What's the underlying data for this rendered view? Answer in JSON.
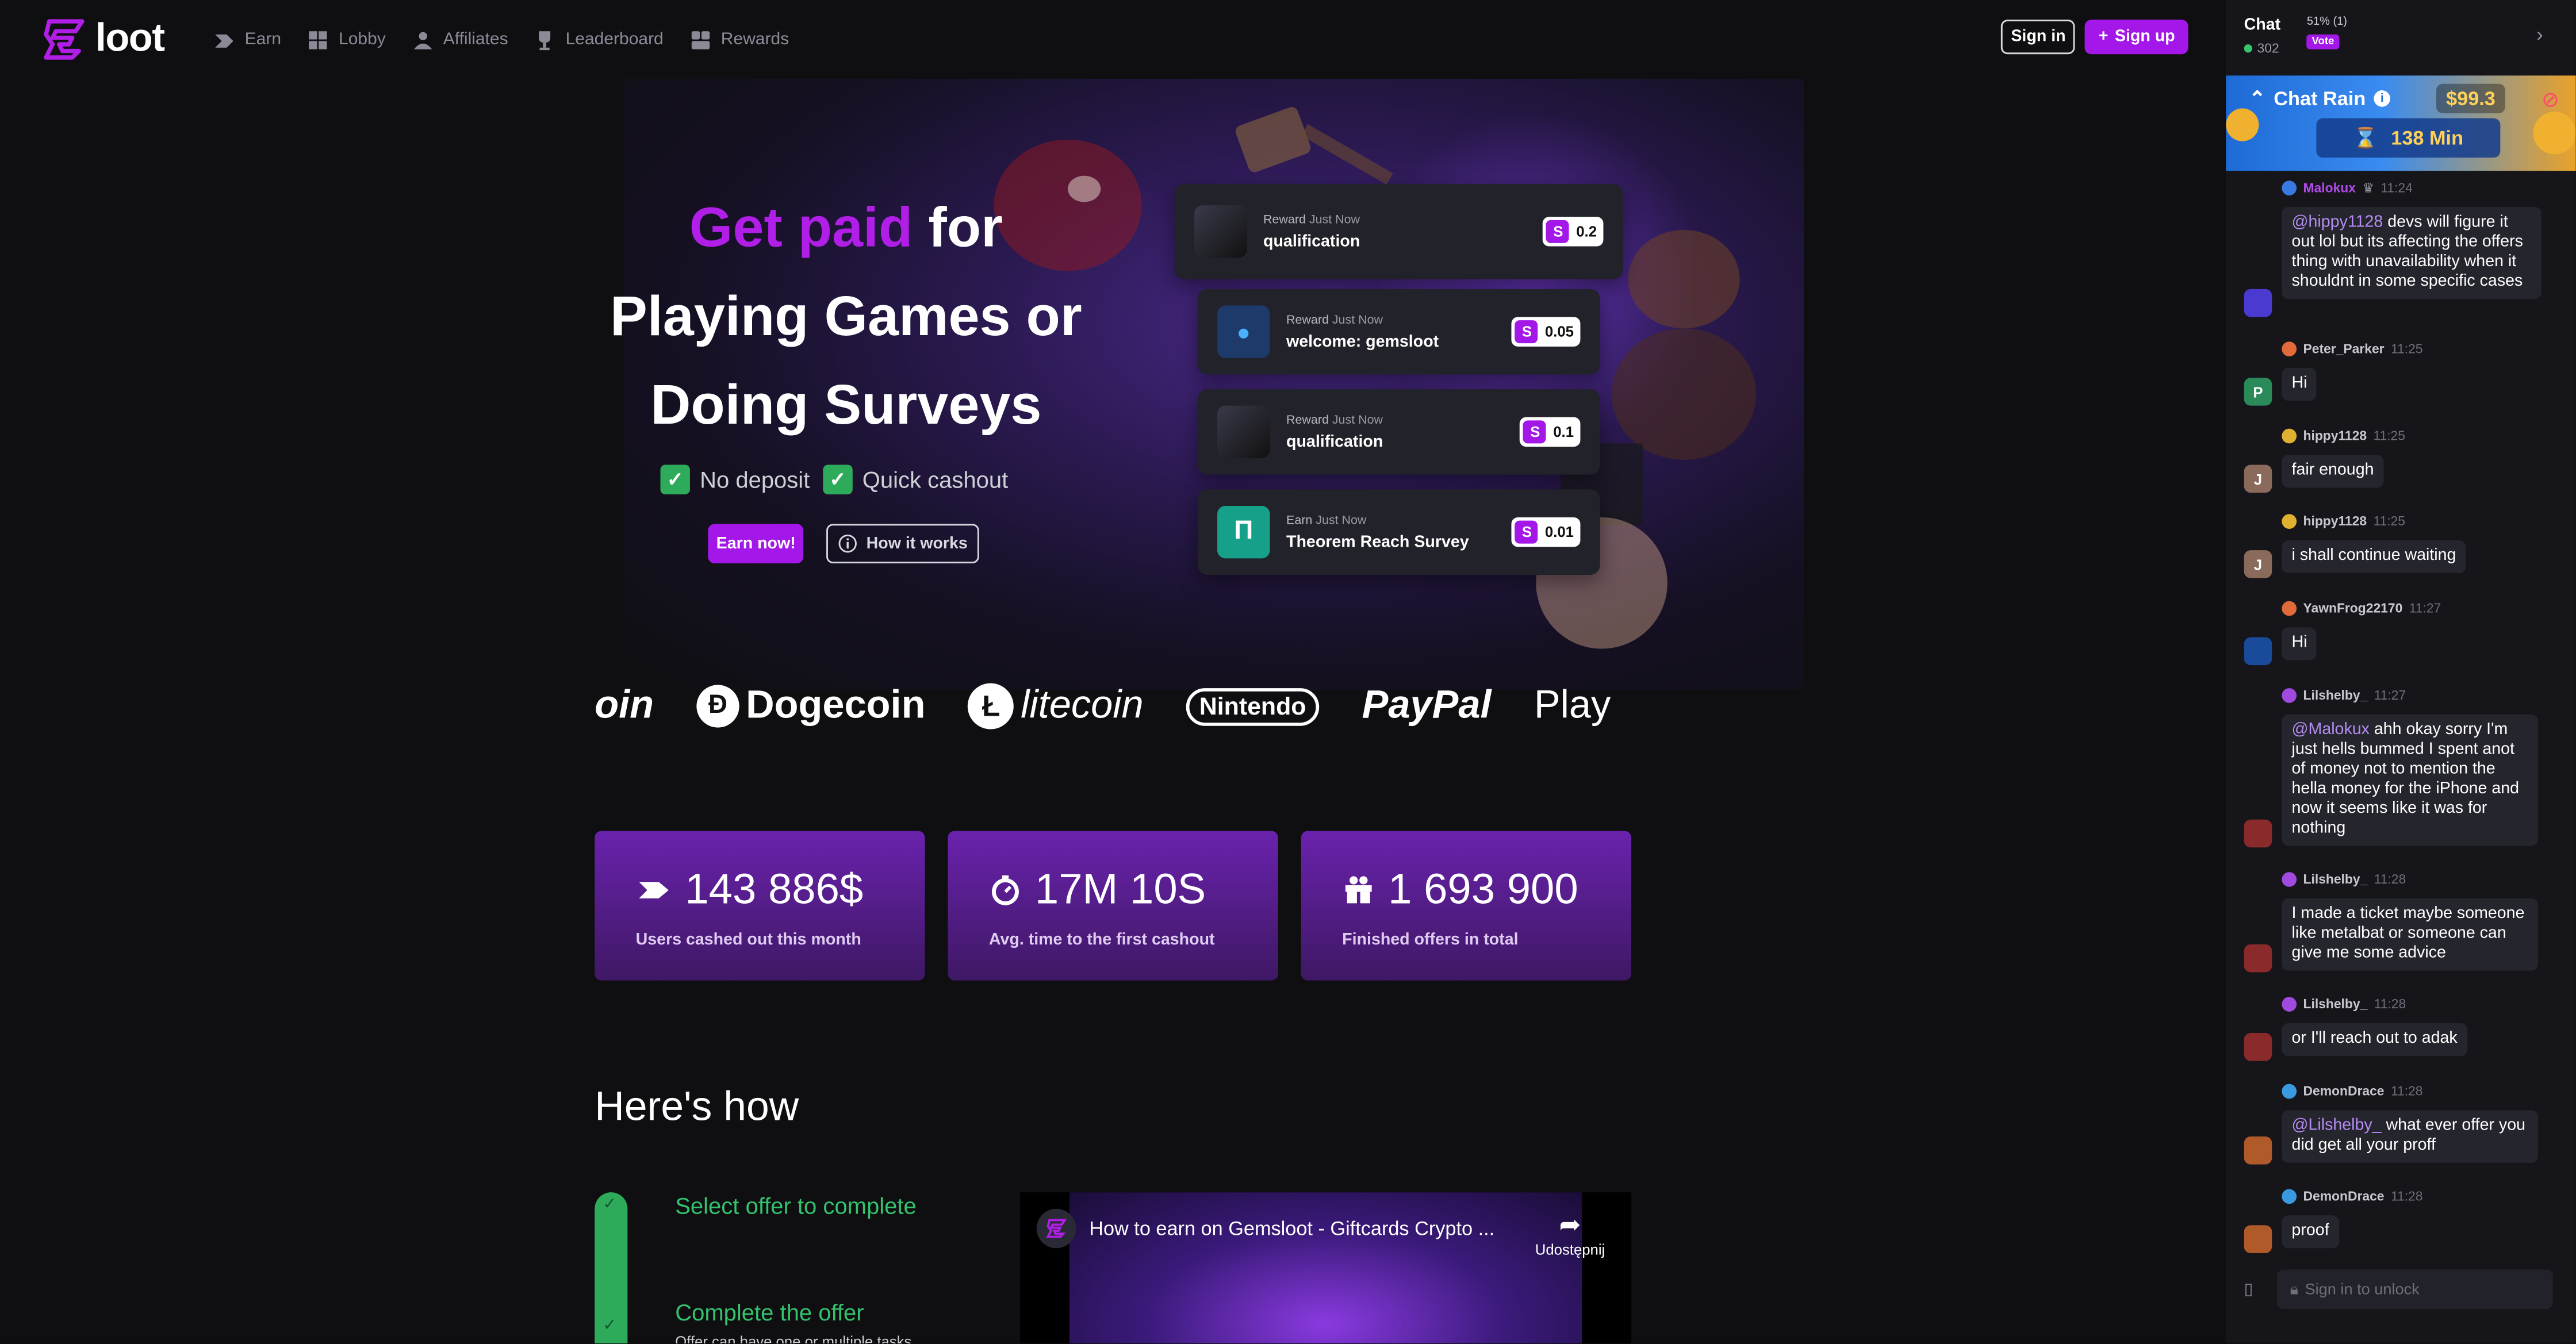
{
  "nav": {
    "logo_text": "loot",
    "items": [
      {
        "label": "Earn",
        "icon": "earn-icon"
      },
      {
        "label": "Lobby",
        "icon": "lobby-icon"
      },
      {
        "label": "Affiliates",
        "icon": "affiliates-icon"
      },
      {
        "label": "Leaderboard",
        "icon": "trophy-icon"
      },
      {
        "label": "Rewards",
        "icon": "rewards-icon"
      }
    ],
    "sign_in": "Sign in",
    "sign_up": "Sign up"
  },
  "hero": {
    "title_highlight": "Get paid",
    "title_line1_rest": " for",
    "title_line2": "Playing Games or",
    "title_line3": "Doing Surveys",
    "perk1": "No deposit",
    "perk2": "Quick cashout",
    "earn_now": "Earn now!",
    "how_it_works": "How it works"
  },
  "rewards": [
    {
      "kind": "Reward",
      "time": "Just Now",
      "title": "qualification",
      "amount": "0.2"
    },
    {
      "kind": "Reward",
      "time": "Just Now",
      "title": "welcome: gemsloot",
      "amount": "0.05"
    },
    {
      "kind": "Reward",
      "time": "Just Now",
      "title": "qualification",
      "amount": "0.1"
    },
    {
      "kind": "Earn",
      "time": "Just Now",
      "title": "Theorem Reach Survey",
      "amount": "0.01"
    }
  ],
  "brands": [
    "oin",
    "Dogecoin",
    "litecoin",
    "Nintendo",
    "PayPal",
    "Play"
  ],
  "stats": [
    {
      "value": "143 886$",
      "label": "Users cashed out this month",
      "icon": "cashout-icon"
    },
    {
      "value": "17M 10S",
      "label": "Avg. time to the first cashout",
      "icon": "stopwatch-icon"
    },
    {
      "value": "1 693 900",
      "label": "Finished offers in total",
      "icon": "gift-icon"
    }
  ],
  "how": {
    "title": "Here's how",
    "step1": "Select offer to complete",
    "step2": "Complete the offer",
    "step2_sub": "Offer can have one or multiple tasks",
    "video_title": "How to earn on Gemsloot - Giftcards Crypto ...",
    "video_share": "Udostępnij"
  },
  "chat": {
    "title": "Chat",
    "online": "302",
    "vote_pct": "51% (1)",
    "vote_label": "Vote",
    "rain_title": "Chat Rain",
    "rain_amount": "$99.3",
    "rain_minutes": "138 Min",
    "input_placeholder": "Sign in to unlock",
    "messages": [
      {
        "name": "Malokux",
        "time": "11:24",
        "mention": "@hippy1128",
        "text": " devs will figure it out lol but its affecting the offers thing with unavailability when it shouldnt in some specific cases",
        "avatar": ""
      },
      {
        "name": "Peter_Parker",
        "time": "11:25",
        "mention": "",
        "text": "Hi",
        "avatar": "P"
      },
      {
        "name": "hippy1128",
        "time": "11:25",
        "mention": "",
        "text": "fair enough",
        "avatar": "J"
      },
      {
        "name": "hippy1128",
        "time": "11:25",
        "mention": "",
        "text": "i shall continue waiting",
        "avatar": "J"
      },
      {
        "name": "YawnFrog22170",
        "time": "11:27",
        "mention": "",
        "text": "Hi",
        "avatar": ""
      },
      {
        "name": "Lilshelby_",
        "time": "11:27",
        "mention": "@Malokux",
        "text": " ahh okay sorry I'm just hells bummed I spent anot of money not to mention the hella money for the iPhone and now it seems like it was for nothing",
        "avatar": ""
      },
      {
        "name": "Lilshelby_",
        "time": "11:28",
        "mention": "",
        "text": "I made a ticket maybe someone like metalbat or someone can give me some advice",
        "avatar": ""
      },
      {
        "name": "Lilshelby_",
        "time": "11:28",
        "mention": "",
        "text": "or I'll reach out to adak",
        "avatar": ""
      },
      {
        "name": "DemonDrace",
        "time": "11:28",
        "mention": "@Lilshelby_",
        "text": " what ever offer you did get all your proff",
        "avatar": ""
      },
      {
        "name": "DemonDrace",
        "time": "11:28",
        "mention": "",
        "text": "proof",
        "avatar": ""
      }
    ]
  },
  "colors": {
    "accent": "#a318e8",
    "green": "#2eab5a",
    "background": "#0f0f12"
  }
}
